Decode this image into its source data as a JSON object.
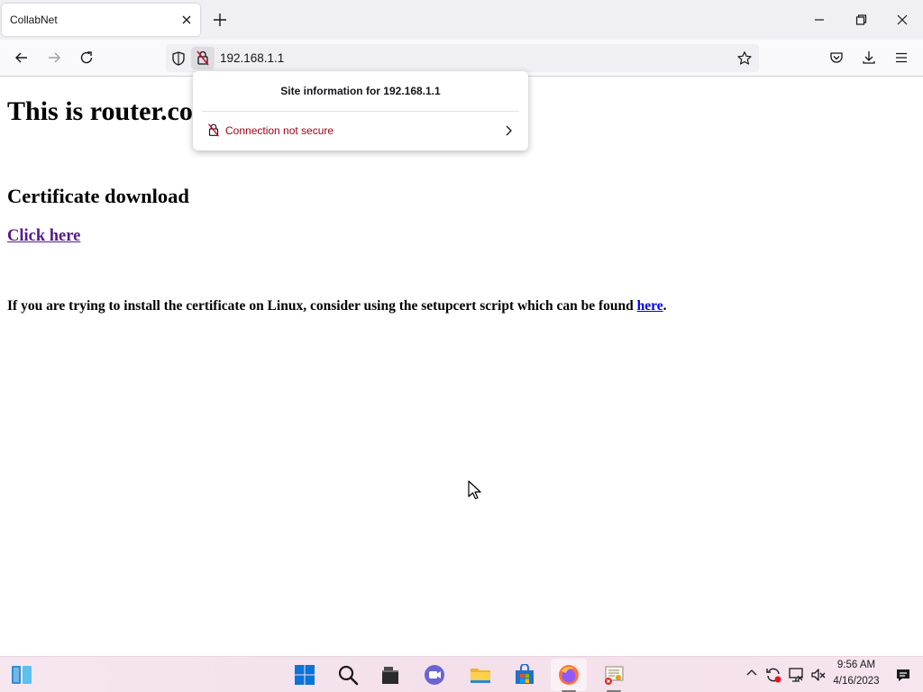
{
  "browser": {
    "tab_title": "CollabNet",
    "url": "192.168.1.1",
    "icons": {
      "tab_close": "close-icon",
      "new_tab": "plus-icon",
      "minimize": "minimize-icon",
      "restore": "restore-icon",
      "close": "close-icon",
      "back": "arrow-left-icon",
      "forward": "arrow-right-icon",
      "reload": "reload-icon",
      "tracking": "shield-icon",
      "site_lock": "broken-lock-icon",
      "bookmark": "star-icon",
      "pocket": "pocket-icon",
      "downloads": "download-icon",
      "menu": "hamburger-menu-icon"
    }
  },
  "site_info_popup": {
    "title": "Site information for 192.168.1.1",
    "connection_label": "Connection not secure",
    "connection_color": "#a4000f"
  },
  "page": {
    "heading": "This is router.co",
    "cert_heading": "Certificate download",
    "cert_link": "Click here",
    "linux_note_prefix": "If you are trying to install the certificate on Linux, consider using the setupcert script which can be found ",
    "linux_note_link": "here",
    "linux_note_suffix": ".",
    "visited_link_color": "#551a8b",
    "link_color": "#0000ee"
  },
  "taskbar": {
    "icons": [
      "widgets-icon",
      "windows-start-icon",
      "search-icon",
      "file-explorer-dark-icon",
      "teams-chat-icon",
      "folder-icon",
      "microsoft-store-icon",
      "firefox-icon",
      "certificate-app-icon"
    ],
    "tray_icons": [
      "chevron-up-icon",
      "sync-icon",
      "network-icon",
      "volume-muted-icon",
      "notification-icon"
    ],
    "time": "9:56 AM",
    "date": "4/16/2023"
  }
}
